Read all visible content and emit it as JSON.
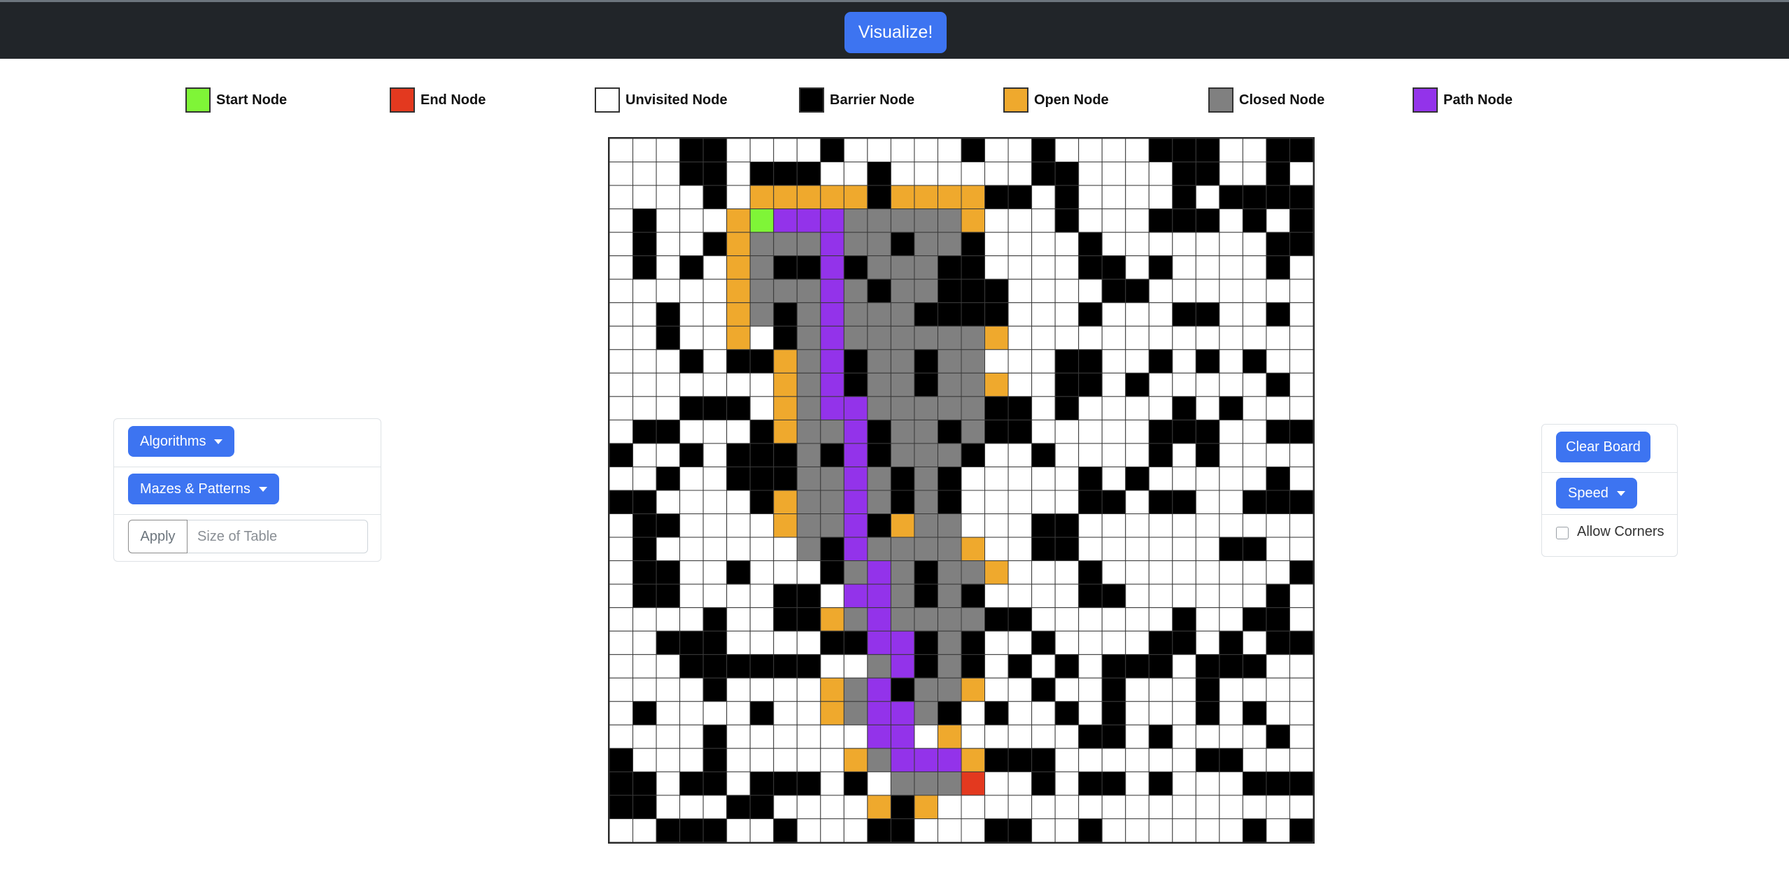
{
  "navbar": {
    "visualize_label": "Visualize!"
  },
  "legend": [
    {
      "name": "start",
      "label": "Start Node",
      "color": "#7ff537"
    },
    {
      "name": "end",
      "label": "End Node",
      "color": "#e3391f"
    },
    {
      "name": "unvisited",
      "label": "Unvisited Node",
      "color": "#ffffff"
    },
    {
      "name": "barrier",
      "label": "Barrier Node",
      "color": "#000000"
    },
    {
      "name": "open",
      "label": "Open Node",
      "color": "#efa92d"
    },
    {
      "name": "closed",
      "label": "Closed Node",
      "color": "#808080"
    },
    {
      "name": "path",
      "label": "Path Node",
      "color": "#9333ea"
    }
  ],
  "left_panel": {
    "algorithms_label": "Algorithms",
    "mazes_label": "Mazes & Patterns",
    "apply_label": "Apply",
    "size_placeholder": "Size of Table",
    "size_value": ""
  },
  "right_panel": {
    "clear_label": "Clear Board",
    "speed_label": "Speed",
    "corners_label": "Allow Corners",
    "corners_checked": false
  },
  "grid": {
    "rows": 30,
    "cols": 30,
    "legend_key": "W=unvisited B=barrier S=start E=end O=open C=closed P=path",
    "cells": [
      "WWWBBWWWWBWWWWWBWWBWWWWBBBWWBBW",
      "WWWBBWBBBWWBWWWWWWBBWWWWBBWWBWW",
      "WWWWBWOOOOOBOOOOBBWBWWWWBWBBBBW",
      "WBWWWOSPPPCCCCCOWWWBWWWBBBWBWB",
      "WBWWBOCCCPCCBCCBWWWWBWWWWWWWBB",
      "WBWBWOCBBPBCCCBBWWWWBBWBWWWWBW",
      "WWWWWOCCCPCBCCBBBWWWWBBWWWWWWW",
      "WWBWWOCBCPCCCBBBBWWWBWWWBBWWBW",
      "WWBWWOWBCPCCCCCCOWWWWWWWWWWWWW",
      "WWWBWBBOCPBCCBCCWWWBBWWBWBWBWW",
      "WWWWWWWOCPBCCBCCOWWBBWBWWWWWBW",
      "WWWBBBWOCPPCCCCCBBWBWWWWBWBWWW",
      "WBBWWWBOCCPBCCBCBBWWWWWBBBWWBBW",
      "BWWBWBBBCBPBCCCBWWBWWWWBWBWWWWW",
      "WWBWWBBBCCPCBCBWWWWWBWBWWWWWBW",
      "BBWWWWBOCCPCBCBWWWWWBBWBBWWBBBW",
      "WBBWWWWOCCPBOCCWWWBBWWWWWWWWWW",
      "WBWWWWWWCBPCCCCOWWBBWWWWWWBBWW",
      "WBBWWBWWWBCPCBCCOWWWBWWWWWWWWBB",
      "WBBWWWWBBWPPCBCBWWWWBBWWWWWWBWB",
      "WWWWBWWBBOCPCCCCBBWWWWWWBWWBBWW",
      "WWBBBWWWWBBPPBCBWWBWWWWBBWBWBBW",
      "WWWBBBBBBWWCPBCBWBWBWBBBWBBBWWW",
      "WWWWBWWWWOCPBCCOWWBWWBWWWBWWWWW",
      "WBWWWWBWWOCPPCBWBWWBWBWWWBWBWWW",
      "WWWWBWWWWWWPPWOWWWWWBBWBWWWWBWWWB",
      "BWWWBWWWWWOCPPPOBBBWWWWWWBBWWWBW",
      "BBWBBWBBBWBWCCCEWWBWBBWBWWWBBBW",
      "BBWWWBBWWWWOBOWWWWWWWWWWWWWWWW",
      "WWBBBWWBWWWBBWWWBBWWBWWWWWWBWB"
    ]
  }
}
